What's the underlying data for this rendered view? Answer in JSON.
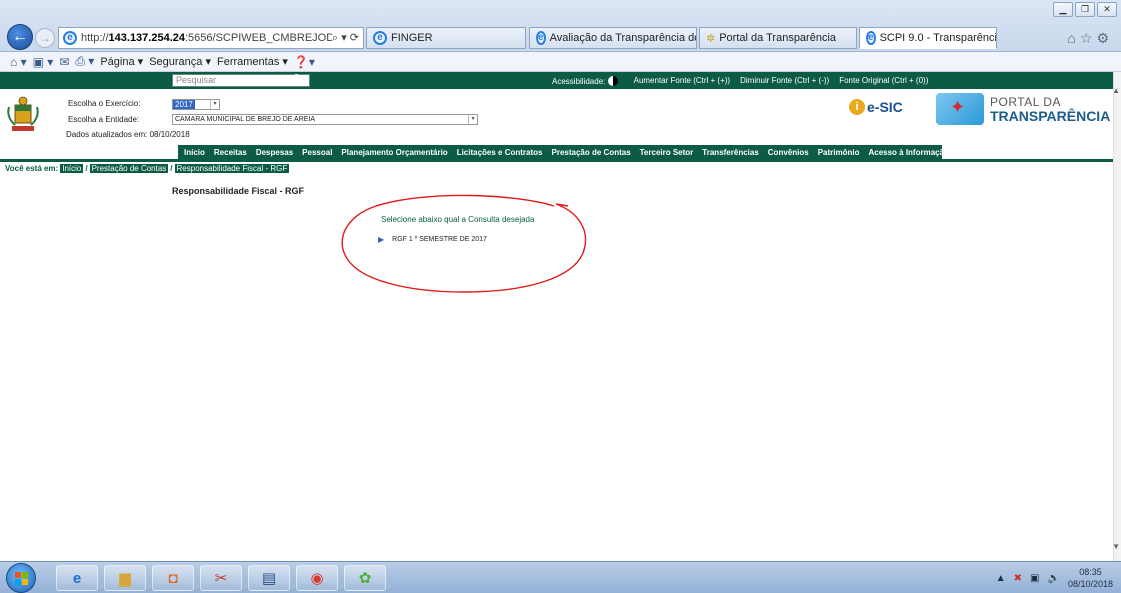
{
  "browser": {
    "address_prefix": "http://",
    "address_host": "143.137.254.24",
    "address_rest": ":5656/SCPIWEB_CMBREJODEARE",
    "address_tools": "⌕ ▾ ⟳",
    "tabs": [
      {
        "label": "FINGER"
      },
      {
        "label": "Avaliação da Transparência do..."
      },
      {
        "label": "Portal da Transparência"
      },
      {
        "label": "SCPI 9.0 - Transparência"
      }
    ],
    "tab_close": "×",
    "commands": {
      "pagina": "Página ▾",
      "seguranca": "Segurança ▾",
      "ferramentas": "Ferramentas ▾"
    }
  },
  "page": {
    "search_placeholder": "Pesquisar",
    "accessibility": {
      "label": "Acessibilidade:",
      "increase": "Aumentar Fonte (Ctrl + (+))",
      "decrease": "Diminuir Fonte (Ctrl + (-))",
      "original": "Fonte Original (Ctrl + (0))"
    },
    "filters": {
      "exercise_label": "Escolha o Exercício:",
      "exercise_value": "2017",
      "entity_label": "Escolha a Entidade:",
      "entity_value": "CAMARA MUNICIPAL DE BREJO DE AREIA",
      "updated": "Dados atualizados em: 08/10/2018"
    },
    "brand": {
      "esic": "e-SIC",
      "portal_line1": "PORTAL DA",
      "portal_line2": "TRANSPARÊNCIA"
    },
    "nav": [
      "Início",
      "Receitas",
      "Despesas",
      "Pessoal",
      "Planejamento Orçamentário",
      "Licitações e Contratos",
      "Prestação de Contas",
      "Terceiro Setor",
      "Transferências",
      "Convênios",
      "Patrimônio",
      "Acesso à Informação"
    ],
    "breadcrumb": {
      "label": "Você está em:",
      "items": [
        "Início",
        "Prestação de Contas",
        "Responsabilidade Fiscal - RGF"
      ],
      "sep": "/"
    },
    "heading": "Responsabilidade Fiscal - RGF",
    "prompt": "Selecione abaixo qual a Consulta desejada",
    "link": "RGF 1 º SEMESTRE DE 2017"
  },
  "taskbar": {
    "time": "08:35",
    "date": "08/10/2018"
  },
  "colors": {
    "site_green": "#0b5b45",
    "annotation_red": "#e01a1a"
  }
}
